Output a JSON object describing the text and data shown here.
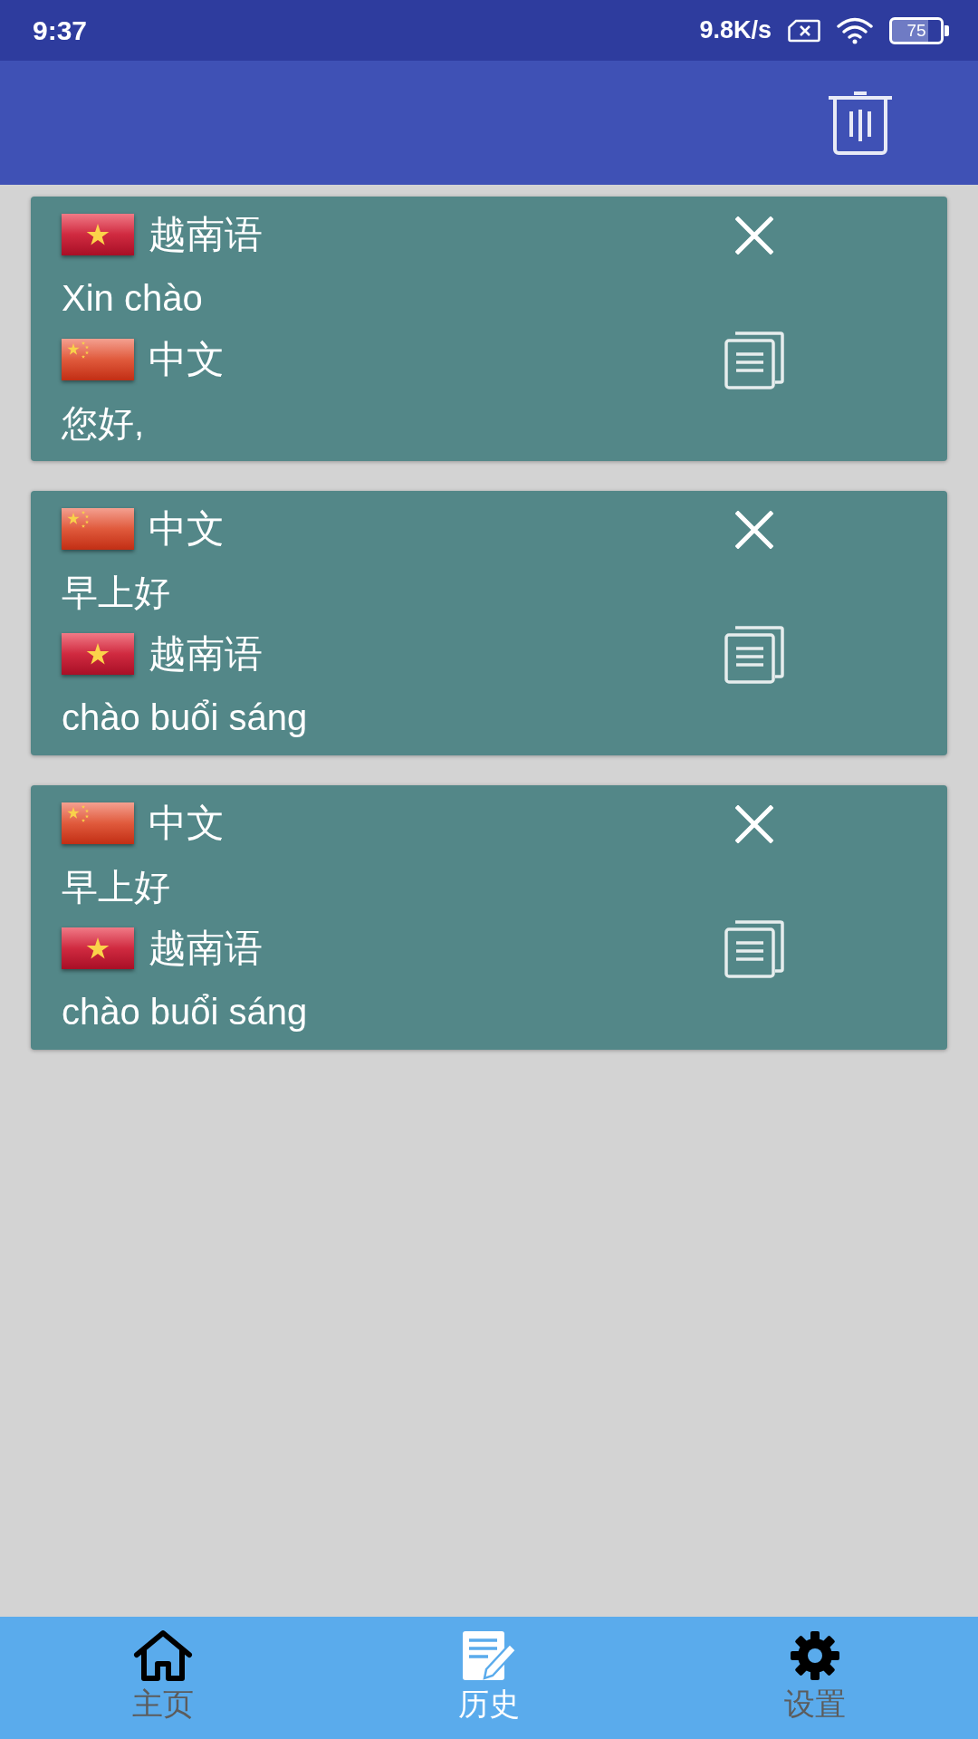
{
  "status_bar": {
    "time": "9:37",
    "net_speed": "9.8K/s",
    "battery": "75"
  },
  "history": [
    {
      "source": {
        "kind": "vn",
        "language": "越南语",
        "text": "Xin chào"
      },
      "target": {
        "kind": "cn",
        "language": "中文",
        "text": "您好,"
      }
    },
    {
      "source": {
        "kind": "cn",
        "language": "中文",
        "text": "早上好"
      },
      "target": {
        "kind": "vn",
        "language": "越南语",
        "text": "chào buổi sáng"
      }
    },
    {
      "source": {
        "kind": "cn",
        "language": "中文",
        "text": "早上好"
      },
      "target": {
        "kind": "vn",
        "language": "越南语",
        "text": "chào buổi sáng"
      }
    }
  ],
  "bottom_nav": [
    {
      "kind": "home",
      "label": "主页",
      "selected": false
    },
    {
      "kind": "history",
      "label": "历史",
      "selected": true
    },
    {
      "kind": "settings",
      "label": "设置",
      "selected": false
    }
  ]
}
